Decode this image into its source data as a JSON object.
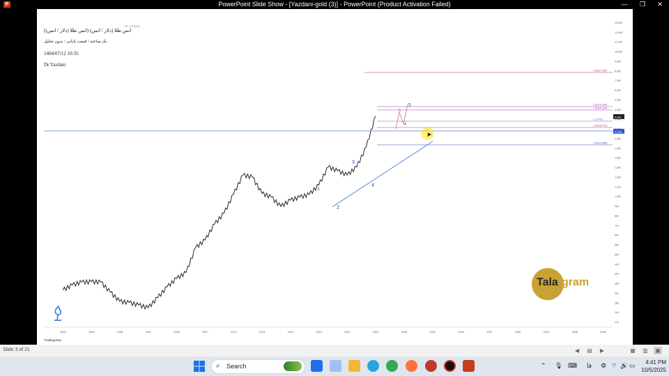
{
  "window": {
    "title": "PowerPoint Slide Show - [Yazdani-gold (3)] - PowerPoint (Product Activation Failed)",
    "minimize": "—",
    "restore": "❐",
    "close": "✕"
  },
  "slide": {
    "title_line": "انس طلا (دلار / انس) (انس طلا (دلار / انس))",
    "subtitle_line": "یک ساعته / قیمت پایانی / بدون تحلیل",
    "datetime": "1404/07/12 10:35",
    "author": "Dr.Yazdani",
    "header_stat": "+31 (+0.84%)",
    "chart_source": "TradingView",
    "watermark_brand_left": "Tala",
    "watermark_brand_right": "gram"
  },
  "chart_data": {
    "type": "line",
    "x_axis_years": [
      "1992",
      "1995",
      "1998",
      "2001",
      "2004",
      "2007",
      "2010",
      "2013",
      "2016",
      "2019",
      "2022",
      "2025",
      "2028",
      "2031",
      "2034",
      "2037",
      "2040",
      "2043",
      "2046",
      "2049"
    ],
    "y_axis_labels": [
      "14,000",
      "12,000",
      "11,200",
      "10,000",
      "9,000",
      "8,000",
      "7,000",
      "6,000",
      "5,000",
      "4,000",
      "3,400",
      "2,800",
      "2,400",
      "2,000",
      "1,800",
      "1,600",
      "1,400",
      "1,240",
      "1,000",
      "900",
      "800",
      "720",
      "600",
      "560",
      "500",
      "440",
      "400",
      "360",
      "320",
      "280",
      "240",
      "210"
    ],
    "price_marker": "3,857",
    "horizontal_line_marker": "3,200",
    "series": [
      {
        "name": "",
        "x": [
          1992,
          1993,
          1994,
          1995,
          1996,
          1997,
          1998,
          1999,
          2000,
          2001,
          2002,
          2003,
          2004,
          2005,
          2006,
          2007,
          2008,
          2009,
          2010,
          2011,
          2012,
          2013,
          2014,
          2015,
          2016,
          2017,
          2018,
          2019,
          2020,
          2021,
          2022,
          2023,
          2024,
          2025
        ],
        "values": [
          345,
          370,
          385,
          387,
          385,
          335,
          295,
          290,
          280,
          270,
          310,
          360,
          405,
          440,
          620,
          690,
          860,
          1000,
          1300,
          1700,
          1650,
          1320,
          1250,
          1100,
          1200,
          1250,
          1300,
          1480,
          1900,
          1800,
          1700,
          1900,
          2500,
          3850
        ]
      }
    ],
    "fib_levels": [
      {
        "label": "2.618 (7,451)",
        "color": "#b03a4c"
      },
      {
        "label": "2.618 (4,348)",
        "color": "#a040b0"
      },
      {
        "label": "1.618 (4,144)",
        "color": "#a040b0"
      },
      {
        "label": "1 (3,745)",
        "color": "#4a6fc0"
      },
      {
        "label": "1.618 (3,414)",
        "color": "#c0405a"
      },
      {
        "label": "1.618 (2,685)",
        "color": "#4040c0"
      }
    ],
    "wave_labels": [
      "1",
      "2",
      "3",
      "4",
      "5",
      "4",
      "5"
    ],
    "colors": {
      "price": "#222222",
      "wave": "#2040c0",
      "trendline": "#3a6fd8",
      "subwave": "#d04060"
    }
  },
  "status": {
    "slide_counter": "Slide 3 of 21"
  },
  "taskbar": {
    "search_placeholder": "Search",
    "time": "4:41 PM",
    "date": "10/5/2025",
    "lang": "فا"
  }
}
